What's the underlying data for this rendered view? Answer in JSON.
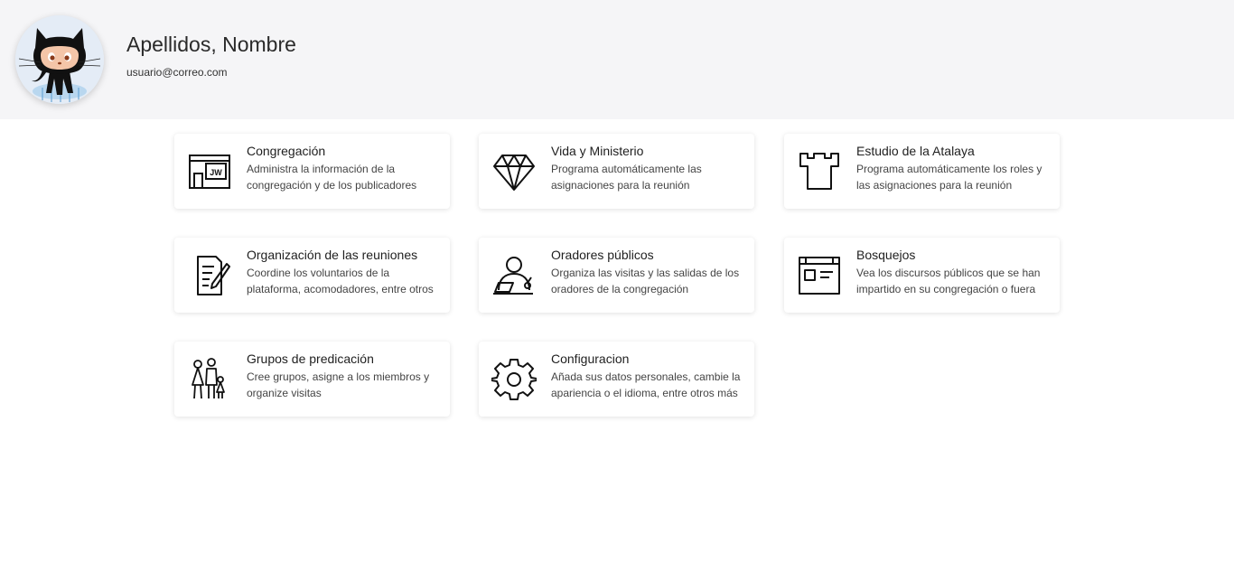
{
  "profile": {
    "name": "Apellidos, Nombre",
    "email": "usuario@correo.com",
    "avatar_icon": "octocat-avatar"
  },
  "cards": [
    {
      "title": "Congregación",
      "description": "Administra la información de la congregación y de los publicadores",
      "icon": "kingdom-hall-icon",
      "icon_text": "JW"
    },
    {
      "title": "Vida y Ministerio",
      "description": "Programa automáticamente las asignaciones para la reunión",
      "icon": "diamond-icon"
    },
    {
      "title": "Estudio de la Atalaya",
      "description": "Programa automáticamente los roles y las asignaciones para la reunión",
      "icon": "watchtower-icon"
    },
    {
      "title": "Organización de las reuniones",
      "description": "Coordine los voluntarios de la plataforma, acomodadores, entre otros",
      "icon": "document-edit-icon"
    },
    {
      "title": "Oradores públicos",
      "description": "Organiza las visitas y las salidas de los oradores de la congregación",
      "icon": "speaker-icon"
    },
    {
      "title": "Bosquejos",
      "description": "Vea los discursos públicos que se han impartido en su congregación o fuera",
      "icon": "newspaper-icon"
    },
    {
      "title": "Grupos de predicación",
      "description": "Cree grupos, asigne a los miembros y organize visitas",
      "icon": "family-group-icon"
    },
    {
      "title": "Configuracion",
      "description": "Añada sus datos personales, cambie la apariencia o el idioma, entre otros más",
      "icon": "gear-icon"
    }
  ]
}
